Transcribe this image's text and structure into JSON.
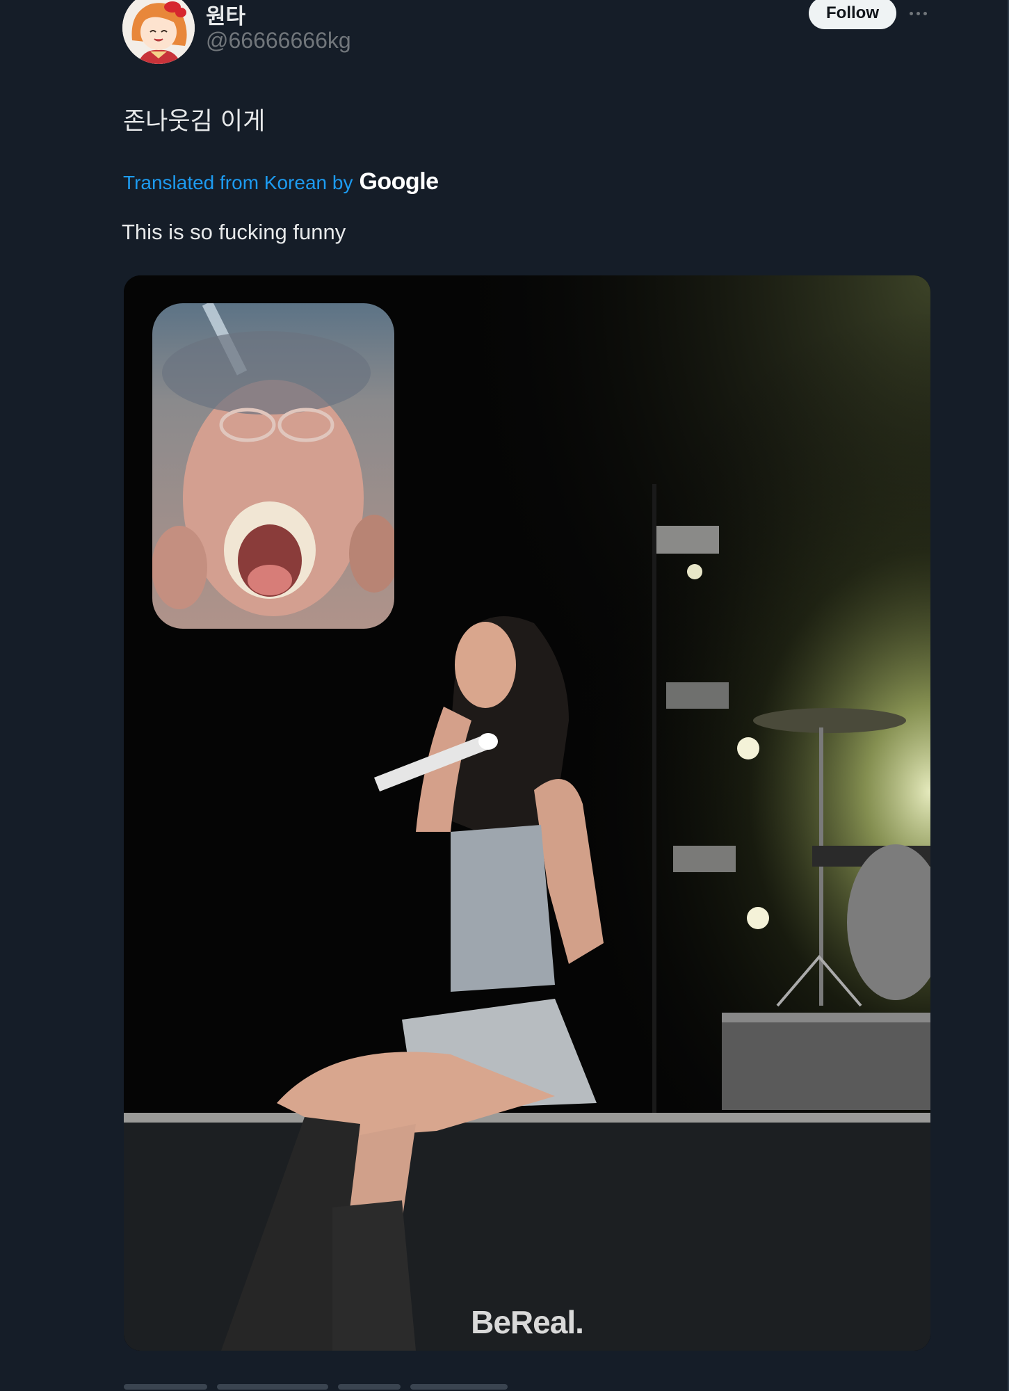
{
  "author": {
    "name": "원타",
    "handle": "@66666666kg",
    "avatar_icon": "avatar-anime-character"
  },
  "follow_label": "Follow",
  "more_icon": "more-horizontal-icon",
  "tweet": {
    "text": "존나웃김 이게"
  },
  "translation": {
    "prefix": "Translated from Korean by",
    "brand": "Google",
    "text": "This is so fucking funny"
  },
  "media": {
    "watermark": "BeReal."
  },
  "colors": {
    "background": "#151d28",
    "link": "#1d9bf0",
    "follow_bg": "#eff3f4",
    "secondary_text": "#71767b"
  }
}
